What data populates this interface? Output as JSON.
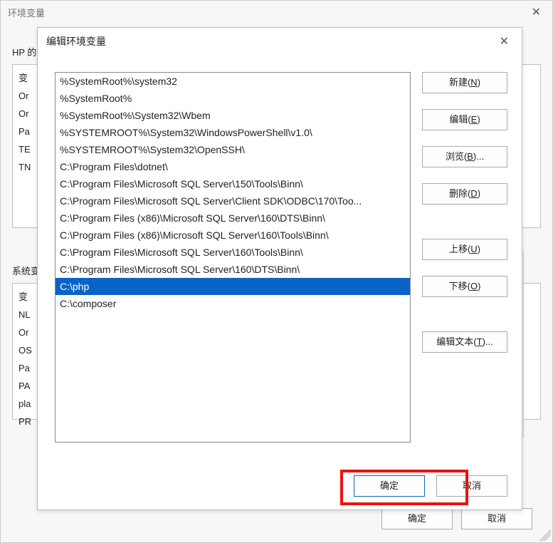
{
  "parent": {
    "title": "环境变量",
    "user_section_label": "HP 的",
    "system_section_label": "系统变",
    "user_vars_visible": [
      "变",
      "Or",
      "Or",
      "Pa",
      "TE",
      "TN"
    ],
    "sys_vars_visible": [
      "变",
      "NL",
      "Or",
      "OS",
      "Pa",
      "PA",
      "pla",
      "PR"
    ],
    "ok_label": "确定",
    "cancel_label": "取消"
  },
  "modal": {
    "title": "编辑环境变量",
    "close_aria": "关闭",
    "items": [
      "%SystemRoot%\\system32",
      "%SystemRoot%",
      "%SystemRoot%\\System32\\Wbem",
      "%SYSTEMROOT%\\System32\\WindowsPowerShell\\v1.0\\",
      "%SYSTEMROOT%\\System32\\OpenSSH\\",
      "C:\\Program Files\\dotnet\\",
      "C:\\Program Files\\Microsoft SQL Server\\150\\Tools\\Binn\\",
      "C:\\Program Files\\Microsoft SQL Server\\Client SDK\\ODBC\\170\\Too...",
      "C:\\Program Files (x86)\\Microsoft SQL Server\\160\\DTS\\Binn\\",
      "C:\\Program Files (x86)\\Microsoft SQL Server\\160\\Tools\\Binn\\",
      "C:\\Program Files\\Microsoft SQL Server\\160\\Tools\\Binn\\",
      "C:\\Program Files\\Microsoft SQL Server\\160\\DTS\\Binn\\",
      "C:\\php",
      "C:\\composer"
    ],
    "selected_index": 12,
    "buttons": {
      "new": {
        "pre": "新建(",
        "hot": "N",
        "post": ")"
      },
      "edit": {
        "pre": "编辑(",
        "hot": "E",
        "post": ")"
      },
      "browse": {
        "pre": "浏览(",
        "hot": "B",
        "post": ")..."
      },
      "delete": {
        "pre": "删除(",
        "hot": "D",
        "post": ")"
      },
      "moveup": {
        "pre": "上移(",
        "hot": "U",
        "post": ")"
      },
      "movedown": {
        "pre": "下移(",
        "hot": "O",
        "post": ")"
      },
      "edittext": {
        "pre": "编辑文本(",
        "hot": "T",
        "post": ")..."
      }
    },
    "ok_label": "确定",
    "cancel_label": "取消"
  }
}
